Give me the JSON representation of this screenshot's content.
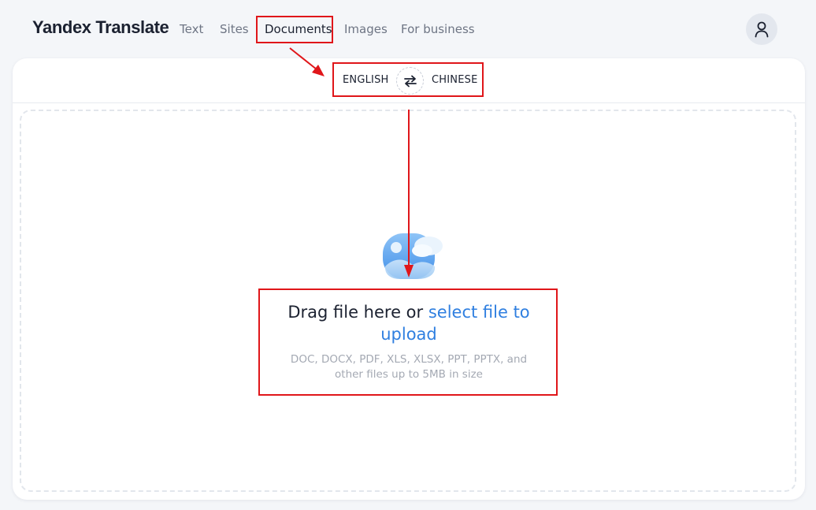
{
  "header": {
    "logo": "Yandex Translate",
    "nav": [
      {
        "label": "Text"
      },
      {
        "label": "Sites"
      },
      {
        "label": "Documents"
      },
      {
        "label": "Images"
      },
      {
        "label": "For business"
      }
    ],
    "active_tab": "Documents",
    "avatar_icon": "user-icon"
  },
  "language_bar": {
    "source": "ENGLISH",
    "target": "CHINESE",
    "swap_icon": "swap-arrows-icon"
  },
  "dropzone": {
    "illustration_icon": "image-cloud-icon",
    "title_prefix": "Drag file here or ",
    "title_link": "select file to upload",
    "subtitle": "DOC, DOCX, PDF, XLS, XLSX, PPT, PPTX, and other files up to 5MB in size"
  },
  "colors": {
    "page_bg": "#f4f6f9",
    "card_bg": "#ffffff",
    "link": "#2f7fe0",
    "annotation": "#e0161a",
    "text_primary": "#1b2130",
    "text_muted": "#a4a9b3"
  }
}
